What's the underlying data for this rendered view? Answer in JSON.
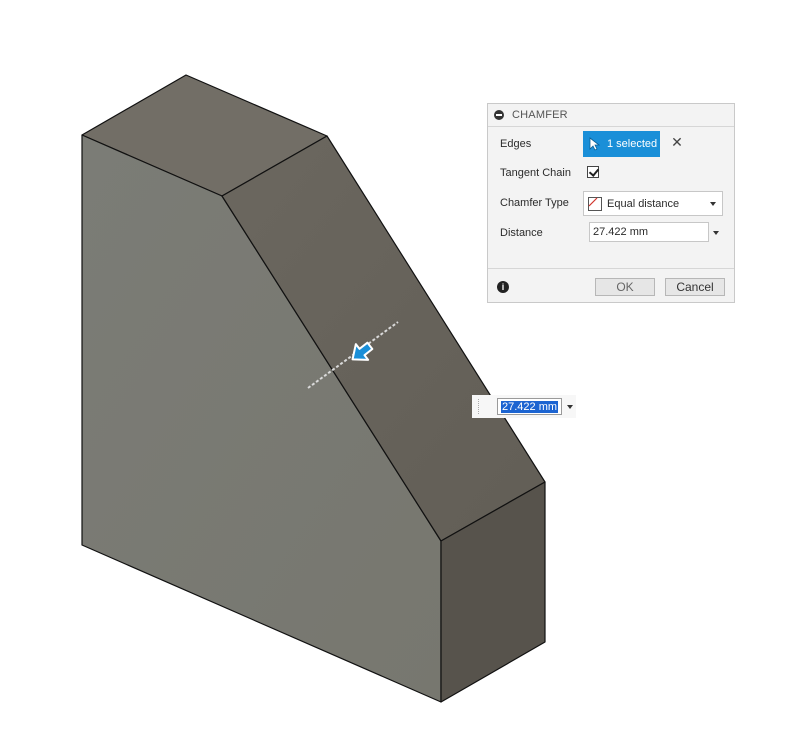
{
  "dialog": {
    "title": "CHAMFER",
    "edges": {
      "label": "Edges",
      "selection": "1 selected"
    },
    "tangent_chain": {
      "label": "Tangent Chain",
      "checked": true
    },
    "chamfer_type": {
      "label": "Chamfer Type",
      "value": "Equal distance"
    },
    "distance": {
      "label": "Distance",
      "value": "27.422 mm"
    },
    "buttons": {
      "ok": "OK",
      "cancel": "Cancel"
    }
  },
  "manipulator": {
    "value": "27.422 mm"
  },
  "colors": {
    "accent": "#1a8fd8",
    "face_front": "#7a7a74",
    "face_chamfer": "#66625a",
    "face_top": "#726e66",
    "face_side": "#57534c"
  },
  "icons": [
    "collapse-icon",
    "select-cursor-icon",
    "close-icon",
    "chamfer-type-icon",
    "chevron-down-icon",
    "info-icon",
    "drag-arrow-icon"
  ]
}
